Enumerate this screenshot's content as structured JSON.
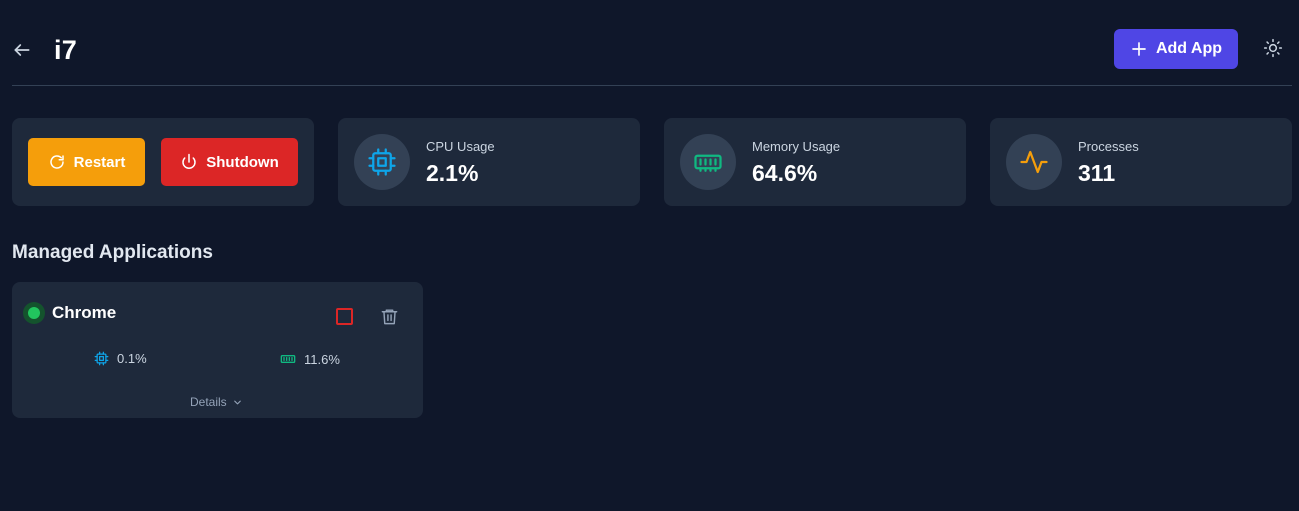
{
  "header": {
    "title": "i7",
    "add_app_label": "Add App",
    "back_icon": "arrow-left-icon",
    "theme_icon": "sun-icon"
  },
  "actions": {
    "restart_label": "Restart",
    "shutdown_label": "Shutdown"
  },
  "stats": [
    {
      "label": "CPU Usage",
      "value": "2.1%",
      "icon": "cpu-icon",
      "color": "#0ea5e9"
    },
    {
      "label": "Memory Usage",
      "value": "64.6%",
      "icon": "memory-icon",
      "color": "#10b981"
    },
    {
      "label": "Processes",
      "value": "311",
      "icon": "activity-icon",
      "color": "#f59e0b"
    }
  ],
  "managed": {
    "title": "Managed Applications",
    "apps": [
      {
        "name": "Chrome",
        "status": "running",
        "cpu": "0.1%",
        "memory": "11.6%",
        "details_label": "Details"
      }
    ]
  },
  "colors": {
    "background": "#0f172a",
    "card": "#1e293b",
    "accent": "#4f46e5",
    "restart": "#f59e0b",
    "shutdown": "#dc2626",
    "running": "#22c55e"
  }
}
